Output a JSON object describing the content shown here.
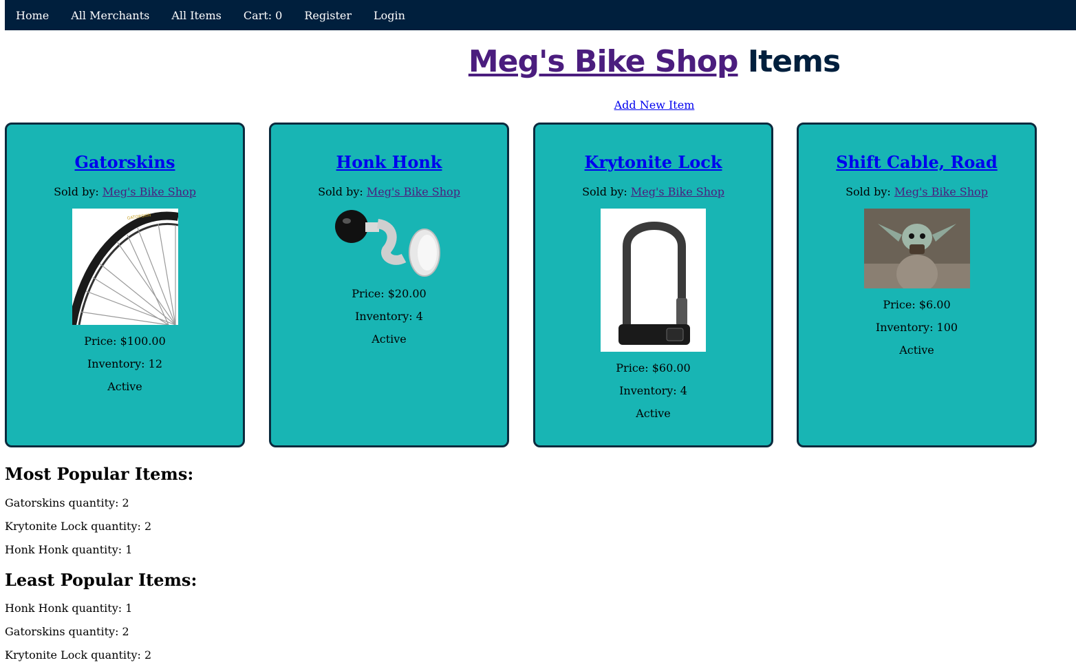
{
  "nav": {
    "home": "Home",
    "merchants": "All Merchants",
    "items": "All Items",
    "cart": "Cart: 0",
    "register": "Register",
    "login": "Login"
  },
  "header": {
    "shop_name": "Meg's Bike Shop",
    "suffix": "Items",
    "add_new_item": "Add New Item"
  },
  "cards": [
    {
      "name": "Gatorskins",
      "sold_by_label": "Sold by:",
      "merchant": "Meg's Bike Shop",
      "image_icon": "bike-tire-image",
      "price": "Price: $100.00",
      "inventory": "Inventory: 12",
      "status": "Active"
    },
    {
      "name": "Honk Honk",
      "sold_by_label": "Sold by:",
      "merchant": "Meg's Bike Shop",
      "image_icon": "bike-horn-image",
      "price": "Price: $20.00",
      "inventory": "Inventory: 4",
      "status": "Active"
    },
    {
      "name": "Krytonite Lock",
      "sold_by_label": "Sold by:",
      "merchant": "Meg's Bike Shop",
      "image_icon": "u-lock-image",
      "price": "Price: $60.00",
      "inventory": "Inventory: 4",
      "status": "Active"
    },
    {
      "name": "Shift Cable, Road",
      "sold_by_label": "Sold by:",
      "merchant": "Meg's Bike Shop",
      "image_icon": "baby-yoda-image",
      "price": "Price: $6.00",
      "inventory": "Inventory: 100",
      "status": "Active"
    }
  ],
  "most_popular": {
    "title": "Most Popular Items:",
    "rows": [
      "Gatorskins quantity: 2",
      "Krytonite Lock quantity: 2",
      "Honk Honk quantity: 1"
    ]
  },
  "least_popular": {
    "title": "Least Popular Items:",
    "rows": [
      "Honk Honk quantity: 1",
      "Gatorskins quantity: 2",
      "Krytonite Lock quantity: 2"
    ]
  },
  "colors": {
    "nav_bg": "#001f3d",
    "card_bg": "#18b5b4",
    "card_border": "#0b2a3d",
    "shop_name": "#4b1d7e",
    "link": "#0000ee"
  }
}
